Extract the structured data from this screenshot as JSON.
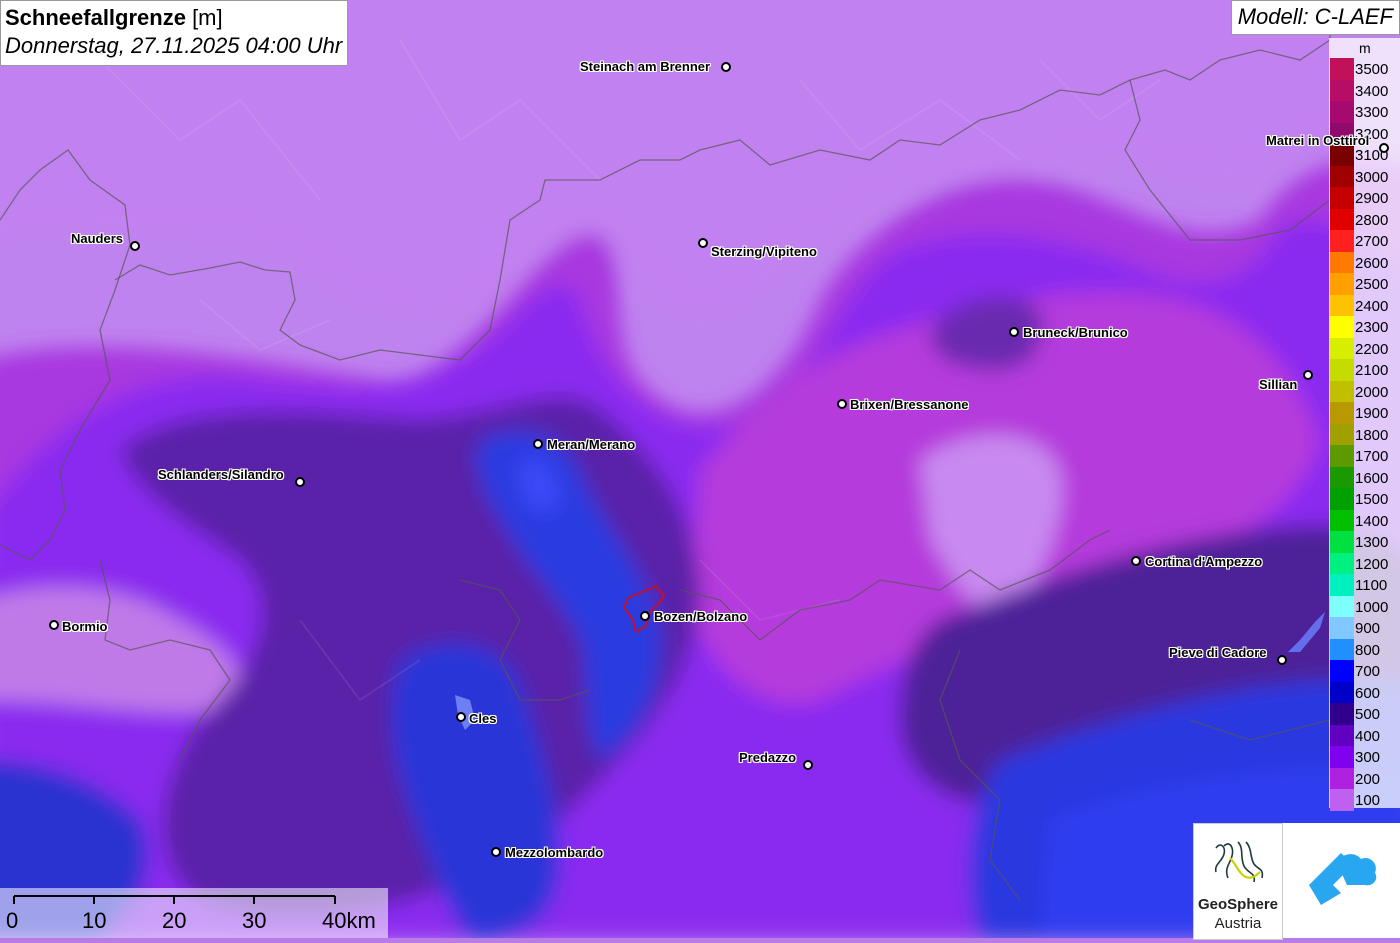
{
  "title": {
    "main_bold": "Schneefallgrenze",
    "main_unit": " [m]",
    "subtitle": "Donnerstag, 27.11.2025 04:00 Uhr"
  },
  "model": "Modell: C-LAEF",
  "legend": {
    "unit": "m",
    "entries": [
      {
        "value": "3500",
        "color": "#c2105a"
      },
      {
        "value": "3400",
        "color": "#b80d66"
      },
      {
        "value": "3300",
        "color": "#a60a6e"
      },
      {
        "value": "3200",
        "color": "#8f0a6a"
      },
      {
        "value": "3100",
        "color": "#7a0000"
      },
      {
        "value": "3000",
        "color": "#a00000"
      },
      {
        "value": "2900",
        "color": "#c40000"
      },
      {
        "value": "2800",
        "color": "#e00000"
      },
      {
        "value": "2700",
        "color": "#ff2020"
      },
      {
        "value": "2600",
        "color": "#ff7a00"
      },
      {
        "value": "2500",
        "color": "#ffa000"
      },
      {
        "value": "2400",
        "color": "#ffc200"
      },
      {
        "value": "2300",
        "color": "#ffff00"
      },
      {
        "value": "2200",
        "color": "#d8ee00"
      },
      {
        "value": "2100",
        "color": "#c4dc00"
      },
      {
        "value": "2000",
        "color": "#c0c000"
      },
      {
        "value": "1900",
        "color": "#b89a00"
      },
      {
        "value": "1800",
        "color": "#a0a000"
      },
      {
        "value": "1700",
        "color": "#5c9a00"
      },
      {
        "value": "1600",
        "color": "#1a9a00"
      },
      {
        "value": "1500",
        "color": "#00a000"
      },
      {
        "value": "1400",
        "color": "#00c000"
      },
      {
        "value": "1300",
        "color": "#00e040"
      },
      {
        "value": "1200",
        "color": "#00f080"
      },
      {
        "value": "1100",
        "color": "#00f0c0"
      },
      {
        "value": "1000",
        "color": "#80ffff"
      },
      {
        "value": "900",
        "color": "#80c8ff"
      },
      {
        "value": "800",
        "color": "#2090ff"
      },
      {
        "value": "700",
        "color": "#0000ff"
      },
      {
        "value": "600",
        "color": "#0000c8"
      },
      {
        "value": "500",
        "color": "#30008c"
      },
      {
        "value": "400",
        "color": "#6000c0"
      },
      {
        "value": "300",
        "color": "#8000f0"
      },
      {
        "value": "200",
        "color": "#b020e0"
      },
      {
        "value": "100",
        "color": "#c060f0"
      }
    ]
  },
  "cities": [
    {
      "name": "Steinach am Brenner"
    },
    {
      "name": "Nauders"
    },
    {
      "name": "Sterzing/Vipiteno"
    },
    {
      "name": "Matrei in Osttirol"
    },
    {
      "name": "Bruneck/Brunico"
    },
    {
      "name": "Sillian"
    },
    {
      "name": "Brixen/Bressanone"
    },
    {
      "name": "Meran/Merano"
    },
    {
      "name": "Schlanders/Silandro"
    },
    {
      "name": "Cortina d'Ampezzo"
    },
    {
      "name": "Bormio"
    },
    {
      "name": "Bozen/Bolzano"
    },
    {
      "name": "Pieve di Cadore"
    },
    {
      "name": "Cles"
    },
    {
      "name": "Predazzo"
    },
    {
      "name": "Mezzolombardo"
    }
  ],
  "scale": {
    "labels": [
      "0",
      "10",
      "20",
      "30",
      "40km"
    ]
  },
  "logo": {
    "line1": "GeoSphere",
    "line2": "Austria"
  }
}
